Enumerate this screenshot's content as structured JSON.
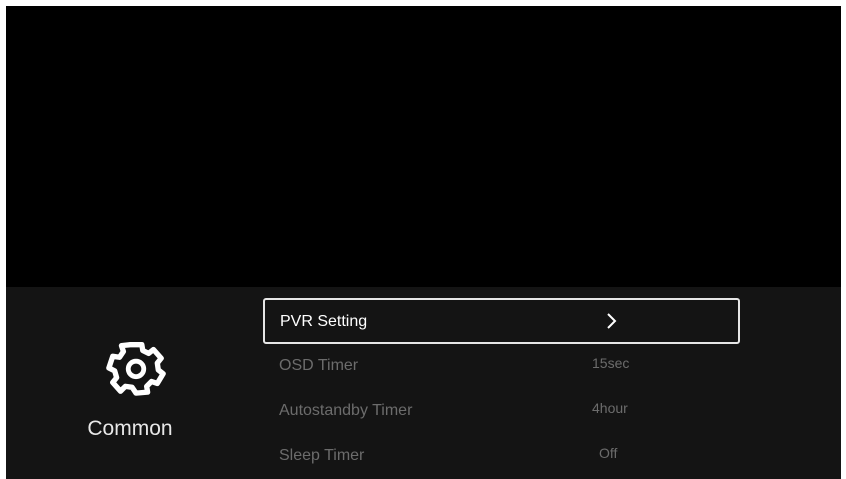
{
  "category": {
    "icon": "gear-icon",
    "label": "Common"
  },
  "menu": {
    "items": [
      {
        "label": "PVR Setting",
        "value": "",
        "icon": "chevron-right-icon",
        "focused": true
      },
      {
        "label": "OSD Timer",
        "value": "15sec"
      },
      {
        "label": "Autostandby Timer",
        "value": "4hour"
      },
      {
        "label": "Sleep Timer",
        "value": "Off"
      }
    ]
  },
  "colors": {
    "background": "#000000",
    "panel": "#141414",
    "focus_border": "#e6e6e6",
    "text_focused": "#ffffff",
    "text_dim": "#6c6c6c"
  }
}
